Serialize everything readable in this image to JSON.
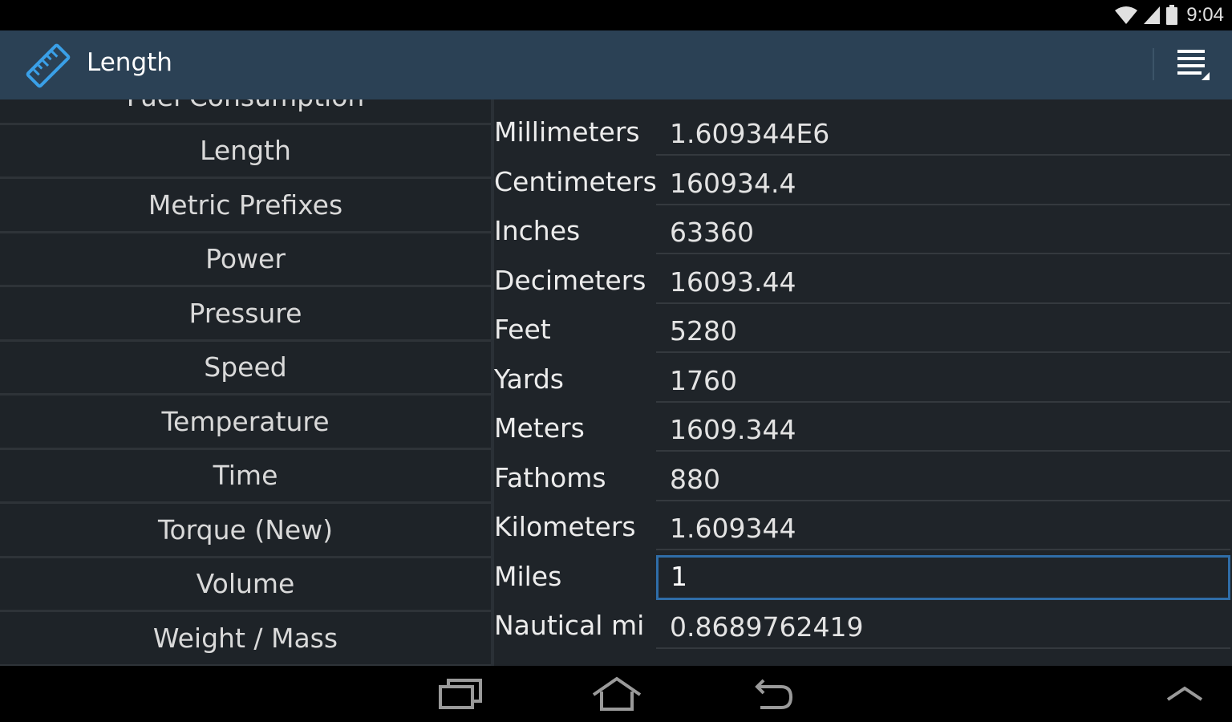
{
  "status_bar": {
    "time": "9:04",
    "icons": [
      "wifi-icon",
      "signal-icon",
      "battery-icon"
    ]
  },
  "action_bar": {
    "title": "Length",
    "app_icon": "ruler-icon",
    "menu_icon": "overflow-menu-icon"
  },
  "categories": {
    "partial_top": "Fuel Consumption",
    "items": [
      "Length",
      "Metric Prefixes",
      "Power",
      "Pressure",
      "Speed",
      "Temperature",
      "Time",
      "Torque (New)",
      "Volume",
      "Weight / Mass"
    ]
  },
  "units": [
    {
      "label": "Millimeters",
      "value": "1.609344E6"
    },
    {
      "label": "Centimeters",
      "value": "160934.4"
    },
    {
      "label": "Inches",
      "value": "63360"
    },
    {
      "label": "Decimeters",
      "value": "16093.44"
    },
    {
      "label": "Feet",
      "value": "5280"
    },
    {
      "label": "Yards",
      "value": "1760"
    },
    {
      "label": "Meters",
      "value": "1609.344"
    },
    {
      "label": "Fathoms",
      "value": "880"
    },
    {
      "label": "Kilometers",
      "value": "1.609344"
    },
    {
      "label": "Miles",
      "value": "1",
      "focused": true
    },
    {
      "label": "Nautical mi",
      "value": "0.8689762419"
    }
  ],
  "nav_bar": {
    "buttons": [
      "recent-apps-icon",
      "home-icon",
      "back-icon",
      "chevron-up-icon"
    ]
  },
  "colors": {
    "action_bar": "#2b4155",
    "accent": "#2f6da8",
    "list_bg": "#1e2328"
  }
}
